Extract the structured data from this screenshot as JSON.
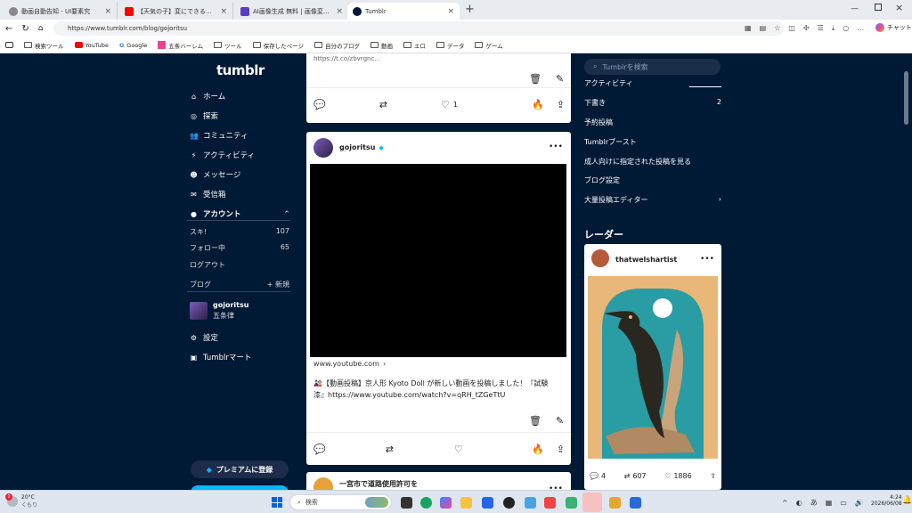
{
  "tabs": [
    {
      "title": "動画自動告知 - UI要素究",
      "close": "×"
    },
    {
      "title": "【天気の子】変にできることはまだある?",
      "close": "×"
    },
    {
      "title": "AI画像生成 無料 | 画像変換ができる",
      "close": "×"
    },
    {
      "title": "Tumblr",
      "close": "×"
    }
  ],
  "new_tab": "+",
  "address": {
    "url": "https://www.tumblr.com/blog/gojoritsu"
  },
  "bookmarks": [
    "検索ツール",
    "YouTube",
    "Google",
    "五条ハーレム",
    "ツール",
    "保存したページ",
    "自分のブログ",
    "動画",
    "エロ",
    "データ",
    "ゲーム"
  ],
  "edge_chat": "チャット",
  "tumblr": {
    "logo": "tumblr",
    "nav": [
      {
        "label": "ホーム",
        "icon": "home-icon"
      },
      {
        "label": "探索",
        "icon": "compass-icon"
      },
      {
        "label": "コミュニティ",
        "icon": "people-icon"
      },
      {
        "label": "アクティビティ",
        "icon": "bolt-icon"
      },
      {
        "label": "メッセージ",
        "icon": "smile-icon"
      },
      {
        "label": "受信箱",
        "icon": "envelope-icon"
      }
    ],
    "account": {
      "label": "アカウント",
      "toggle": "^"
    },
    "account_items": [
      {
        "label": "スキ!",
        "count": "107"
      },
      {
        "label": "フォロー中",
        "count": "65"
      },
      {
        "label": "ログアウト",
        "count": ""
      }
    ],
    "blog": {
      "label": "ブログ",
      "new": "+ 新規"
    },
    "blog_entry": {
      "name": "gojoritsu",
      "title": "五条律"
    },
    "settings": "設定",
    "mart": "Tumblrマート",
    "premium": "プレミアムに登録",
    "post1": {
      "top_text": "https://t.co/zbvrgnc...",
      "like_count": "1"
    },
    "post2": {
      "author": "gojoritsu",
      "more": "•••",
      "link": "www.youtube.com",
      "link_arrow": "›",
      "body": "🎎【動画投稿】京人形 Kyoto Doll が新しい動画を投稿しました！『試験漆』https://www.youtube.com/watch?v=qRH_tZGeTtU"
    },
    "post3": {
      "title": "一宮市で道路使用許可を",
      "more": "•••"
    },
    "search_placeholder": "Tumblrを検索",
    "right_menu": [
      {
        "label": "アクティビティ",
        "value": ""
      },
      {
        "label": "下書き",
        "value": "2"
      },
      {
        "label": "予約投稿",
        "value": ""
      },
      {
        "label": "Tumblrブースト",
        "value": ""
      },
      {
        "label": "成人向けに指定された投稿を見る",
        "value": ""
      },
      {
        "label": "ブログ設定",
        "value": ""
      },
      {
        "label": "大量投稿エディター",
        "value": "›"
      }
    ],
    "radar": {
      "heading": "レーダー",
      "author": "thatwelshartist",
      "more": "•••",
      "comments": "4",
      "reblogs": "607",
      "likes": "1886"
    }
  },
  "taskbar": {
    "temp": "20°C",
    "weather": "くもり",
    "search": "検索",
    "time": "4:24",
    "date": "2026/06/08",
    "ime": "あ",
    "badge": "1"
  },
  "colors": {
    "tumblr_bg": "#001935",
    "premium": "#00b8ff"
  }
}
